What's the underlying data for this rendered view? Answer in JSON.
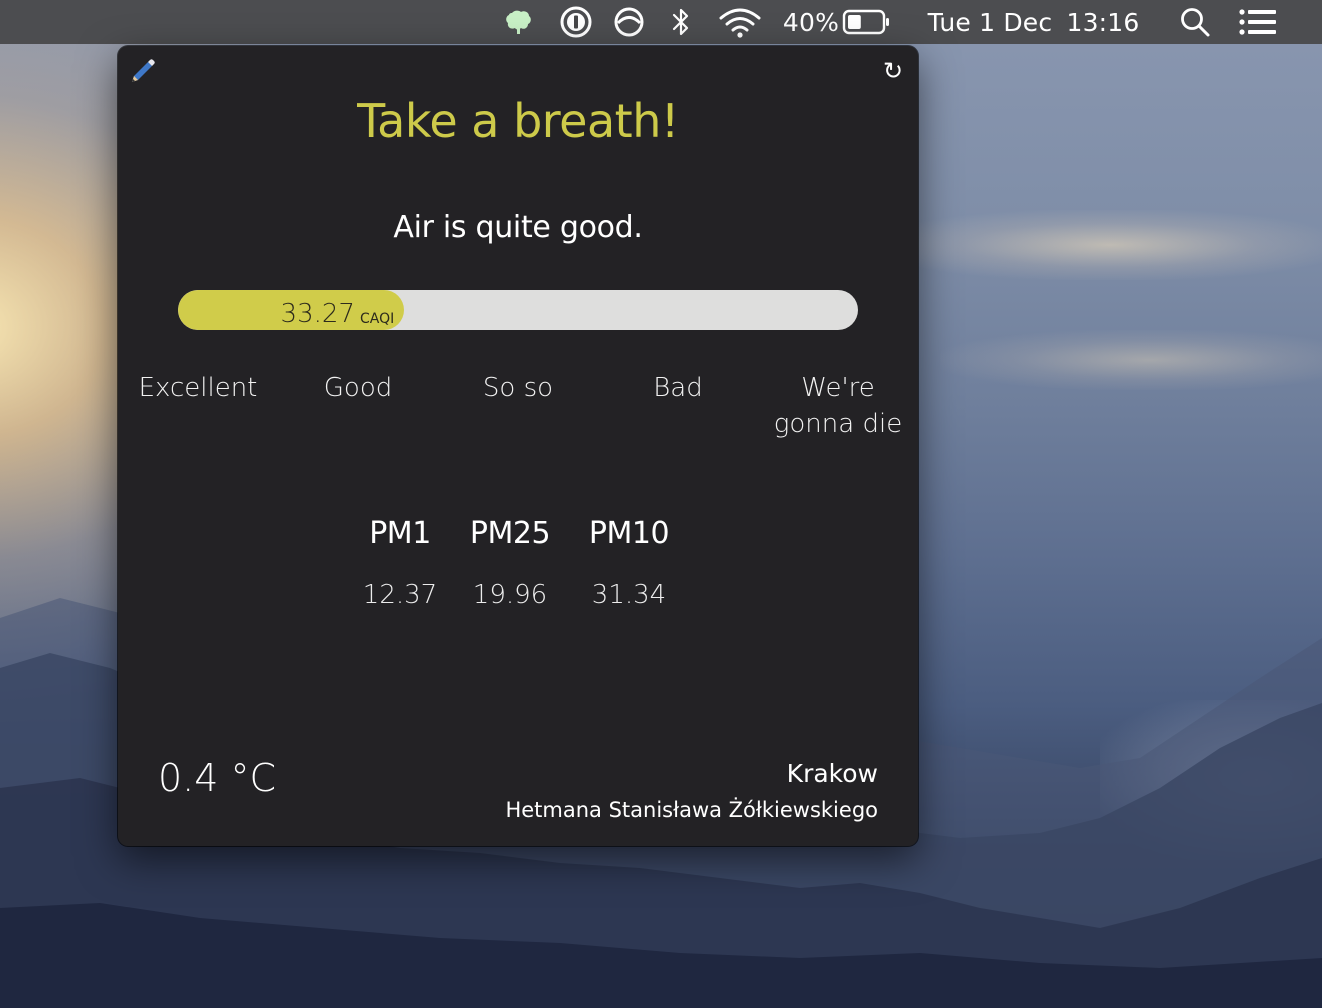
{
  "menubar": {
    "battery_percent_label": "40%",
    "battery_level": 0.4,
    "date": "Tue 1 Dec",
    "time": "13:16",
    "icons": {
      "app": "leaf-cloud-icon",
      "password_manager": "onepassword-icon",
      "vpn": "half-circle-icon",
      "bluetooth": "bluetooth-icon",
      "wifi": "wifi-icon",
      "battery": "battery-icon",
      "search": "search-icon",
      "notifications": "list-icon"
    },
    "app_icon_color": "#c8f0c6"
  },
  "widget": {
    "edit_icon": "pencil-icon",
    "refresh_icon": "refresh-icon",
    "refresh_glyph": "↻",
    "title": "Take a breath!",
    "status": "Air is quite good.",
    "index": {
      "value": "33.27",
      "unit": "CAQI",
      "level_percent": 33.27,
      "fill_color": "#d0cc4a"
    },
    "scale": [
      {
        "label": "Excellent"
      },
      {
        "label": "Good"
      },
      {
        "label": "So so"
      },
      {
        "label": "Bad"
      },
      {
        "label": "We're gonna die"
      }
    ],
    "particulates": [
      {
        "name": "PM1",
        "value": "12.37"
      },
      {
        "name": "PM25",
        "value": "19.96"
      },
      {
        "name": "PM10",
        "value": "31.34"
      }
    ],
    "temperature": "0.4 °C",
    "city": "Krakow",
    "street": "Hetmana Stanisława Żółkiewskiego",
    "title_color": "#cdca4a"
  }
}
